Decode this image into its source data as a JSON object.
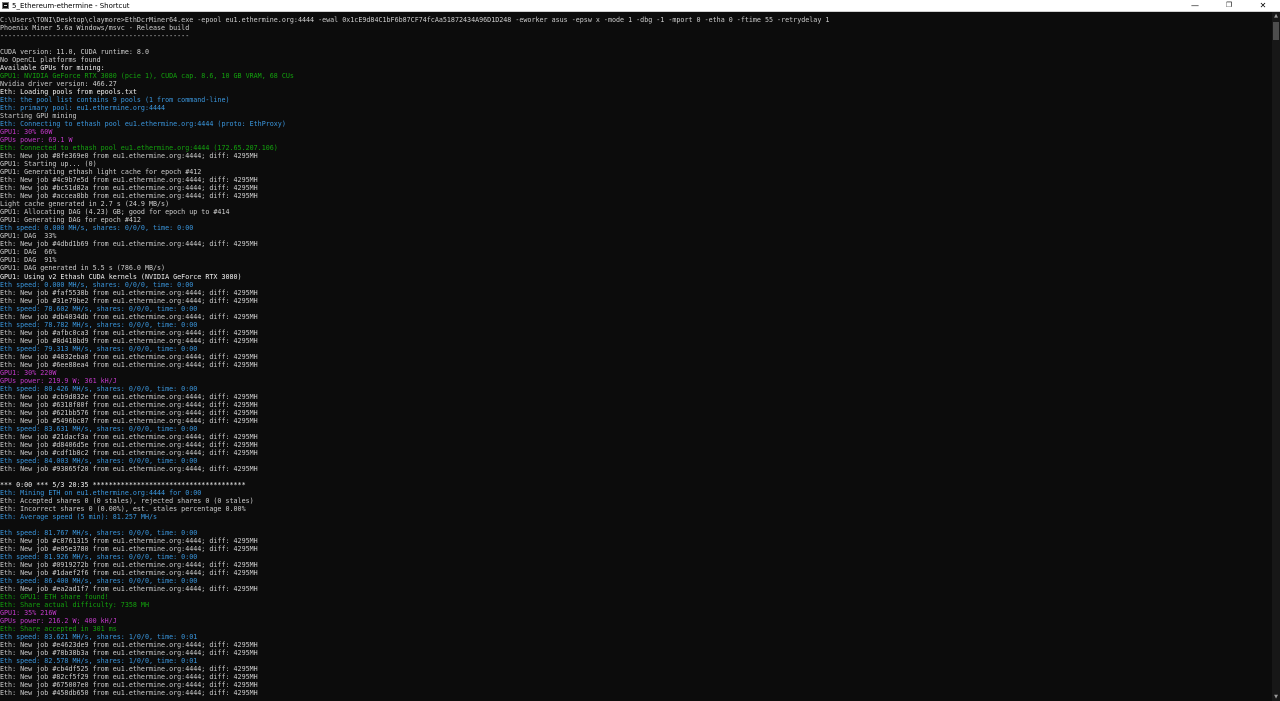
{
  "window": {
    "title": "5_Ethereum-ethermine - Shortcut",
    "minimize_glyph": "—",
    "maximize_glyph": "❐",
    "close_glyph": "✕",
    "icon": "console-app-icon"
  },
  "scrollbar": {
    "up_glyph": "▲",
    "down_glyph": "▼"
  },
  "colors": {
    "background": "#0c0c0c",
    "default_text": "#cccccc",
    "green": "#13a10e",
    "teal": "#3a96dd",
    "magenta": "#c239c9"
  },
  "console_lines": [
    {
      "t": "C:\\Users\\TONI\\Desktop\\claymore>EthDcrMiner64.exe -epool eu1.ethermine.org:4444 -ewal 0x1cE9d84C1bF6b87CF74fcAa51872434A96D1D248 -eworker asus -epsw x -mode 1 -dbg -1 -mport 0 -etha 0 -ftime 55 -retrydelay 1",
      "c": "w"
    },
    {
      "t": "Phoenix Miner 5.6a Windows/msvc - Release build",
      "c": "w"
    },
    {
      "t": "-----------------------------------------------",
      "c": "w"
    },
    {
      "t": "",
      "c": "w"
    },
    {
      "t": "CUDA version: 11.0, CUDA runtime: 8.0",
      "c": "w"
    },
    {
      "t": "No OpenCL platforms found",
      "c": "w"
    },
    {
      "t": "Available GPUs for mining:",
      "c": "bw"
    },
    {
      "t": "GPU1: NVIDIA GeForce RTX 3080 (pcie 1), CUDA cap. 8.6, 10 GB VRAM, 68 CUs",
      "c": "g"
    },
    {
      "t": "Nvidia driver version: 466.27",
      "c": "w"
    },
    {
      "t": "Eth: Loading pools from epools.txt",
      "c": "bw"
    },
    {
      "t": "Eth: the pool list contains 9 pools (1 from command-line)",
      "c": "t"
    },
    {
      "t": "Eth: primary pool: eu1.ethermine.org:4444",
      "c": "t"
    },
    {
      "t": "Starting GPU mining",
      "c": "w"
    },
    {
      "t": "Eth: Connecting to ethash pool eu1.ethermine.org:4444 (proto: EthProxy)",
      "c": "t"
    },
    {
      "t": "GPU1: 30% 60W",
      "c": "m"
    },
    {
      "t": "GPUs power: 69.1 W",
      "c": "m"
    },
    {
      "t": "Eth: Connected to ethash pool eu1.ethermine.org:4444 (172.65.207.106)",
      "c": "g"
    },
    {
      "t": "Eth: New job #8fe369e0 from eu1.ethermine.org:4444; diff: 4295MH",
      "c": "w"
    },
    {
      "t": "GPU1: Starting up... (0)",
      "c": "w"
    },
    {
      "t": "GPU1: Generating ethash light cache for epoch #412",
      "c": "w"
    },
    {
      "t": "Eth: New job #4c9b7e5d from eu1.ethermine.org:4444; diff: 4295MH",
      "c": "w"
    },
    {
      "t": "Eth: New job #bc51d82a from eu1.ethermine.org:4444; diff: 4295MH",
      "c": "w"
    },
    {
      "t": "Eth: New job #accea8bb from eu1.ethermine.org:4444; diff: 4295MH",
      "c": "w"
    },
    {
      "t": "Light cache generated in 2.7 s (24.9 MB/s)",
      "c": "w"
    },
    {
      "t": "GPU1: Allocating DAG (4.23) GB; good for epoch up to #414",
      "c": "w"
    },
    {
      "t": "GPU1: Generating DAG for epoch #412",
      "c": "w"
    },
    {
      "t": "Eth speed: 0.000 MH/s, shares: 0/0/0, time: 0:00",
      "c": "t"
    },
    {
      "t": "GPU1: DAG  33%",
      "c": "w"
    },
    {
      "t": "Eth: New job #4dbd1b69 from eu1.ethermine.org:4444; diff: 4295MH",
      "c": "w"
    },
    {
      "t": "GPU1: DAG  66%",
      "c": "w"
    },
    {
      "t": "GPU1: DAG  91%",
      "c": "w"
    },
    {
      "t": "GPU1: DAG generated in 5.5 s (786.0 MB/s)",
      "c": "w"
    },
    {
      "t": "GPU1: Using v2 Ethash CUDA kernels (NVIDIA GeForce RTX 3080)",
      "c": "bw"
    },
    {
      "t": "Eth speed: 0.000 MH/s, shares: 0/0/0, time: 0:00",
      "c": "t"
    },
    {
      "t": "Eth: New job #faf5538b from eu1.ethermine.org:4444; diff: 4295MH",
      "c": "w"
    },
    {
      "t": "Eth: New job #31e79be2 from eu1.ethermine.org:4444; diff: 4295MH",
      "c": "w"
    },
    {
      "t": "Eth speed: 78.602 MH/s, shares: 0/0/0, time: 0:00",
      "c": "t"
    },
    {
      "t": "Eth: New job #db4034db from eu1.ethermine.org:4444; diff: 4295MH",
      "c": "w"
    },
    {
      "t": "Eth speed: 78.782 MH/s, shares: 0/0/0, time: 0:00",
      "c": "t"
    },
    {
      "t": "Eth: New job #afbc0ca3 from eu1.ethermine.org:4444; diff: 4295MH",
      "c": "w"
    },
    {
      "t": "Eth: New job #8d418bd9 from eu1.ethermine.org:4444; diff: 4295MH",
      "c": "w"
    },
    {
      "t": "Eth speed: 79.313 MH/s, shares: 0/0/0, time: 0:00",
      "c": "t"
    },
    {
      "t": "Eth: New job #4832eba8 from eu1.ethermine.org:4444; diff: 4295MH",
      "c": "w"
    },
    {
      "t": "Eth: New job #6ee88ea4 from eu1.ethermine.org:4444; diff: 4295MH",
      "c": "w"
    },
    {
      "t": "GPU1: 30% 220W",
      "c": "m"
    },
    {
      "t": "GPUs power: 219.9 W; 361 kH/J",
      "c": "m"
    },
    {
      "t": "Eth speed: 80.426 MH/s, shares: 0/0/0, time: 0:00",
      "c": "t"
    },
    {
      "t": "Eth: New job #cb9d832e from eu1.ethermine.org:4444; diff: 4295MH",
      "c": "w"
    },
    {
      "t": "Eth: New job #6318f80f from eu1.ethermine.org:4444; diff: 4295MH",
      "c": "w"
    },
    {
      "t": "Eth: New job #621bb576 from eu1.ethermine.org:4444; diff: 4295MH",
      "c": "w"
    },
    {
      "t": "Eth: New job #5496bc87 from eu1.ethermine.org:4444; diff: 4295MH",
      "c": "w"
    },
    {
      "t": "Eth speed: 83.631 MH/s, shares: 0/0/0, time: 0:00",
      "c": "t"
    },
    {
      "t": "Eth: New job #21dacf3a from eu1.ethermine.org:4444; diff: 4295MH",
      "c": "w"
    },
    {
      "t": "Eth: New job #d8406d5e from eu1.ethermine.org:4444; diff: 4295MH",
      "c": "w"
    },
    {
      "t": "Eth: New job #cdf1b8c2 from eu1.ethermine.org:4444; diff: 4295MH",
      "c": "w"
    },
    {
      "t": "Eth speed: 84.003 MH/s, shares: 0/0/0, time: 0:00",
      "c": "t"
    },
    {
      "t": "Eth: New job #93865f20 from eu1.ethermine.org:4444; diff: 4295MH",
      "c": "w"
    },
    {
      "t": "",
      "c": "w"
    },
    {
      "t": "*** 0:00 *** 5/3 20:35 **************************************",
      "c": "bw"
    },
    {
      "t": "Eth: Mining ETH on eu1.ethermine.org:4444 for 0:00",
      "c": "t"
    },
    {
      "t": "Eth: Accepted shares 0 (0 stales), rejected shares 0 (0 stales)",
      "c": "w"
    },
    {
      "t": "Eth: Incorrect shares 0 (0.00%), est. stales percentage 0.00%",
      "c": "w"
    },
    {
      "t": "Eth: Average speed (5 min): 81.257 MH/s",
      "c": "t"
    },
    {
      "t": "",
      "c": "w"
    },
    {
      "t": "Eth speed: 81.767 MH/s, shares: 0/0/0, time: 0:00",
      "c": "t"
    },
    {
      "t": "Eth: New job #c8761315 from eu1.ethermine.org:4444; diff: 4295MH",
      "c": "w"
    },
    {
      "t": "Eth: New job #e05e3780 from eu1.ethermine.org:4444; diff: 4295MH",
      "c": "w"
    },
    {
      "t": "Eth speed: 81.926 MH/s, shares: 0/0/0, time: 0:00",
      "c": "t"
    },
    {
      "t": "Eth: New job #0919272b from eu1.ethermine.org:4444; diff: 4295MH",
      "c": "w"
    },
    {
      "t": "Eth: New job #1daef2f6 from eu1.ethermine.org:4444; diff: 4295MH",
      "c": "w"
    },
    {
      "t": "Eth speed: 86.400 MH/s, shares: 0/0/0, time: 0:00",
      "c": "t"
    },
    {
      "t": "Eth: New job #ea2ad1f7 from eu1.ethermine.org:4444; diff: 4295MH",
      "c": "w"
    },
    {
      "t": "Eth: GPU1: ETH share found!",
      "c": "g"
    },
    {
      "t": "Eth: Share actual difficulty: 7358 MH",
      "c": "g"
    },
    {
      "t": "GPU1: 35% 216W",
      "c": "m"
    },
    {
      "t": "GPUs power: 216.2 W; 400 kH/J",
      "c": "m"
    },
    {
      "t": "Eth: Share accepted in 301 ms",
      "c": "g"
    },
    {
      "t": "Eth speed: 83.621 MH/s, shares: 1/0/0, time: 0:01",
      "c": "t"
    },
    {
      "t": "Eth: New job #e4623de9 from eu1.ethermine.org:4444; diff: 4295MH",
      "c": "w"
    },
    {
      "t": "Eth: New job #78b38b3a from eu1.ethermine.org:4444; diff: 4295MH",
      "c": "w"
    },
    {
      "t": "Eth speed: 82.578 MH/s, shares: 1/0/0, time: 0:01",
      "c": "t"
    },
    {
      "t": "Eth: New job #cb4df525 from eu1.ethermine.org:4444; diff: 4295MH",
      "c": "w"
    },
    {
      "t": "Eth: New job #82cf5f29 from eu1.ethermine.org:4444; diff: 4295MH",
      "c": "w"
    },
    {
      "t": "Eth: New job #675007e0 from eu1.ethermine.org:4444; diff: 4295MH",
      "c": "w"
    },
    {
      "t": "Eth: New job #458db650 from eu1.ethermine.org:4444; diff: 4295MH",
      "c": "w"
    }
  ]
}
